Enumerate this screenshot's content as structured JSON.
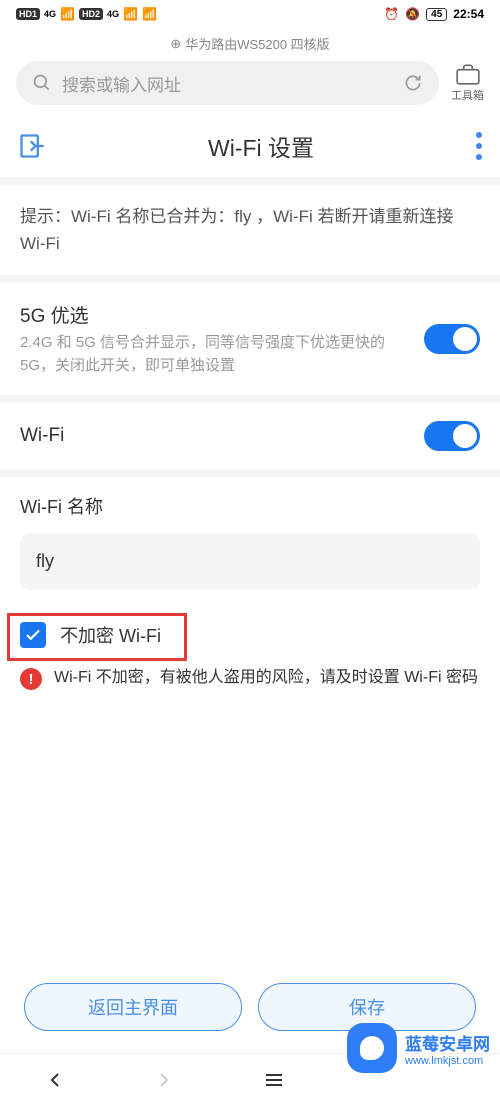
{
  "status": {
    "hd1": "HD1",
    "hd2": "HD2",
    "net1": "4G",
    "net2": "4G",
    "battery": "45",
    "time": "22:54"
  },
  "browser": {
    "title": "华为路由WS5200 四核版",
    "search_placeholder": "搜索或输入网址",
    "toolbox": "工具箱"
  },
  "header": {
    "title": "Wi-Fi 设置"
  },
  "tip": {
    "text": "提示：Wi-Fi 名称已合并为：fly ，Wi-Fi 若断开请重新连接 Wi-Fi"
  },
  "prefer5g": {
    "title": "5G 优选",
    "desc": "2.4G 和 5G 信号合并显示，同等信号强度下优选更快的 5G，关闭此开关，即可单独设置"
  },
  "wifi": {
    "title": "Wi-Fi"
  },
  "name": {
    "label": "Wi-Fi 名称",
    "value": "fly"
  },
  "noencrypt": {
    "label": "不加密 Wi-Fi"
  },
  "warning": {
    "icon": "!",
    "text": "Wi-Fi 不加密，有被他人盗用的风险，请及时设置 Wi-Fi 密码"
  },
  "buttons": {
    "back": "返回主界面",
    "save": "保存"
  },
  "watermark": {
    "title": "蓝莓安卓网",
    "url": "www.lmkjst.com"
  }
}
